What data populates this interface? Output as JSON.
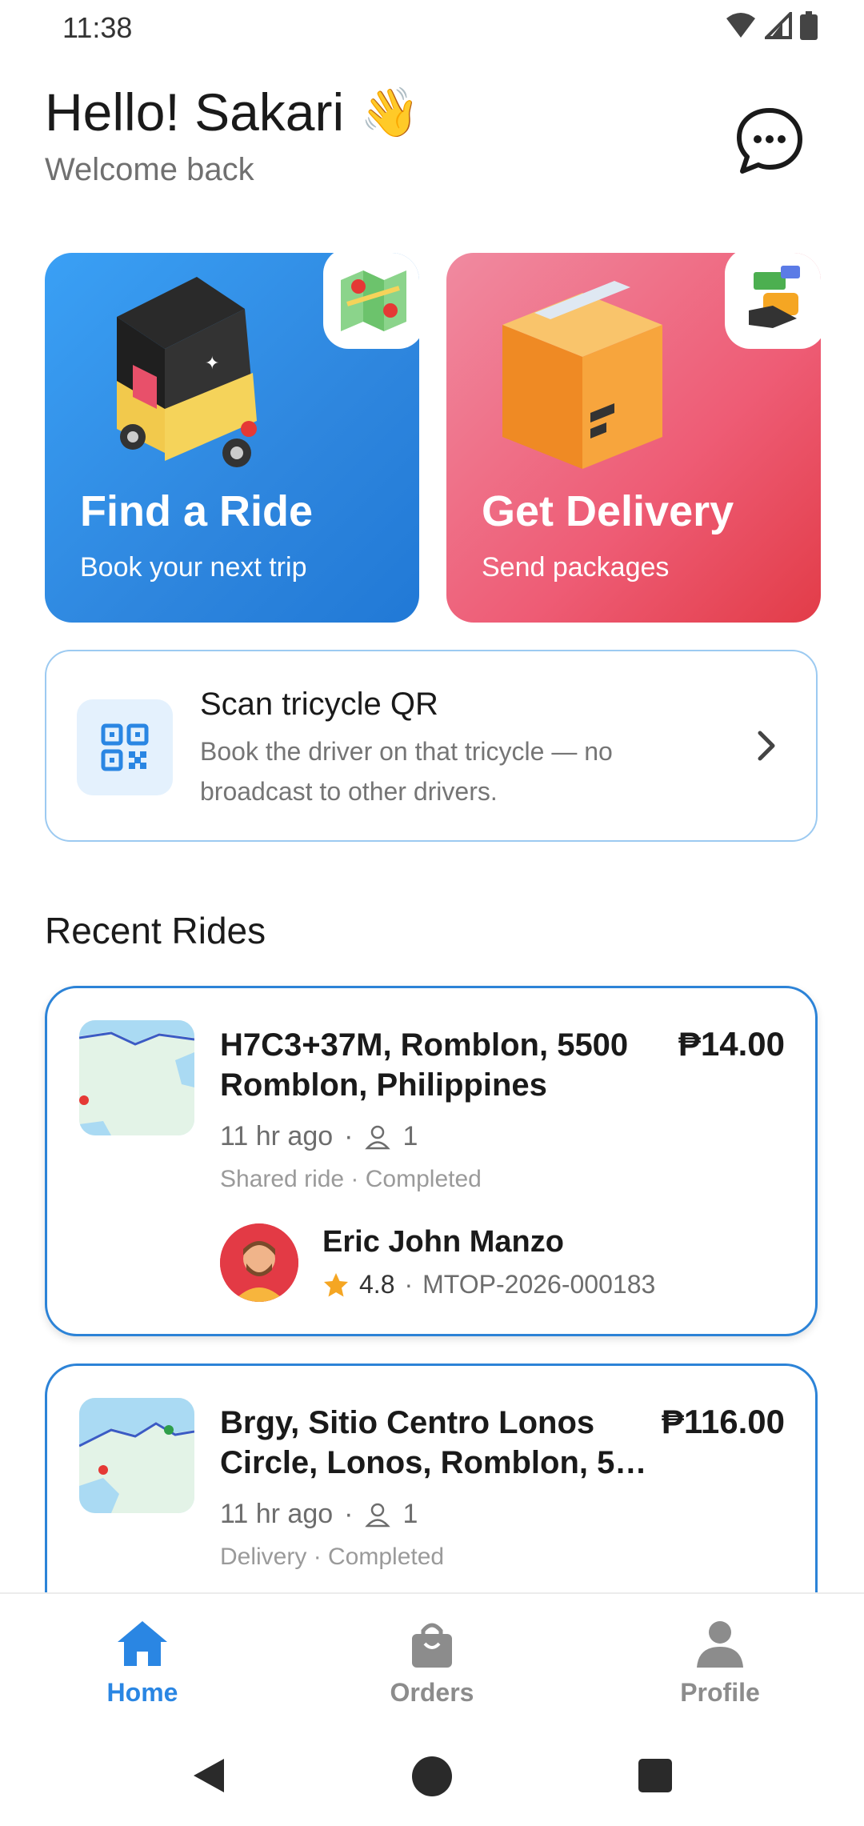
{
  "status_bar": {
    "time": "11:38"
  },
  "header": {
    "greeting": "Hello! Sakari",
    "wave": "👋",
    "subtitle": "Welcome back"
  },
  "cards": {
    "ride": {
      "title": "Find a Ride",
      "subtitle": "Book your next trip"
    },
    "delivery": {
      "title": "Get Delivery",
      "subtitle": "Send packages"
    }
  },
  "scan": {
    "title": "Scan tricycle QR",
    "description": "Book the driver on that tricycle — no broadcast to other drivers."
  },
  "recent": {
    "title": "Recent Rides",
    "rides": [
      {
        "address": "H7C3+37M, Romblon, 5500 Romblon, Philippines",
        "price": "₱14.00",
        "time_ago": "11 hr ago",
        "passengers": "1",
        "status": "Shared ride · Completed",
        "driver": {
          "name": "Eric John Manzo",
          "rating": "4.8",
          "plate": "MTOP-2026-000183"
        }
      },
      {
        "address": "Brgy, Sitio Centro Lonos Circle, Lonos, Romblon, 5…",
        "price": "₱116.00",
        "time_ago": "11 hr ago",
        "passengers": "1",
        "status": "Delivery · Completed"
      }
    ]
  },
  "nav": {
    "home": "Home",
    "orders": "Orders",
    "profile": "Profile"
  },
  "colors": {
    "accent": "#2a86e3",
    "ride_card": "#2e86de",
    "delivery_card": "#ee5c75",
    "star": "#f5a623"
  }
}
